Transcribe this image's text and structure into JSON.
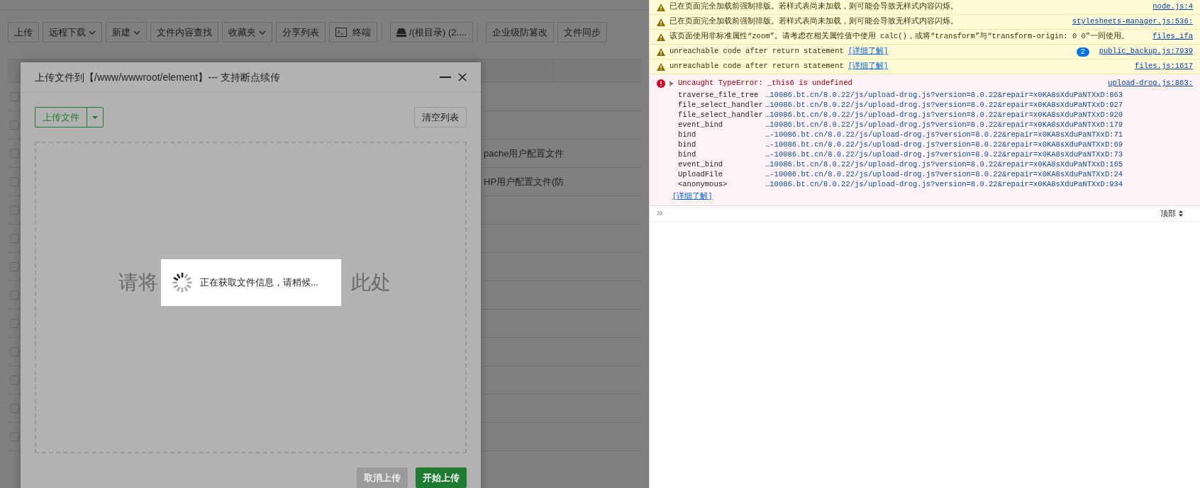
{
  "toolbar": [
    {
      "label": "上传",
      "kind": "plain"
    },
    {
      "label": "远程下载",
      "kind": "dropdown"
    },
    {
      "label": "新建",
      "kind": "dropdown"
    },
    {
      "label": "文件内容查找",
      "kind": "plain"
    },
    {
      "label": "收藏夹",
      "kind": "dropdown"
    },
    {
      "label": "分享列表",
      "kind": "plain"
    },
    {
      "label": "终端",
      "kind": "terminal"
    },
    {
      "label": "/(根目录) (2....",
      "kind": "disk"
    },
    {
      "label": "企业级防篡改",
      "kind": "plain"
    },
    {
      "label": "文件同步",
      "kind": "plain"
    }
  ],
  "table": {
    "rows": [
      {
        "checked": false
      },
      {
        "checked": false
      },
      {
        "checked": false,
        "cell": "pache用户配置文件"
      },
      {
        "checked": false,
        "cell": "HP用户配置文件(防"
      },
      {
        "checked": false
      },
      {
        "checked": false
      },
      {
        "checked": false
      },
      {
        "checked": false
      },
      {
        "checked": false
      },
      {
        "checked": false
      },
      {
        "checked": false
      },
      {
        "checked": false
      },
      {
        "checked": false
      }
    ]
  },
  "dialog": {
    "title": "上传文件到【/www/wwwroot/element】--- 支持断点续传",
    "upload_button": "上传文件",
    "clear_button": "清空列表",
    "drop_text_left": "请将",
    "drop_text_right": "此处",
    "loading": "正在获取文件信息，请稍候...",
    "cancel_button": {
      "label": "取消上传",
      "disabled": true
    },
    "start_button": {
      "label": "开始上传",
      "disabled": false
    }
  },
  "console": {
    "messages": [
      {
        "kind": "warning",
        "text": "已在页面完全加载前强制排版。若样式表尚未加载，则可能会导致无样式内容闪烁。",
        "source": "node.js:4"
      },
      {
        "kind": "warning",
        "text": "已在页面完全加载前强制排版。若样式表尚未加载，则可能会导致无样式内容闪烁。",
        "source": "stylesheets-manager.js:536:"
      },
      {
        "kind": "warning",
        "text": "该页面使用非标准属性“zoom”。请考虑在相关属性值中使用 calc()，或将“transform”与“transform-origin: 0 0”一同使用。",
        "source": "files_ifa"
      },
      {
        "kind": "warning",
        "text": "unreachable code after return statement",
        "link": "[详细了解]",
        "count": "2",
        "source": "public_backup.js:7939"
      },
      {
        "kind": "warning",
        "text": "unreachable code after return statement",
        "link": "[详细了解]",
        "source": "files.js:1617"
      },
      {
        "kind": "error",
        "text": "Uncaught TypeError: _this6 is undefined",
        "source": "upload-drog.js:863:",
        "expanded": false,
        "stack": [
          {
            "fn": "traverse_file_tree",
            "url": "…10086.bt.cn/8.0.22/js/upload-drog.js?version=8.0.22&repair=x0KA8sXduPaNTXxD:863"
          },
          {
            "fn": "file_select_handler",
            "url": "…10086.bt.cn/8.0.22/js/upload-drog.js?version=8.0.22&repair=x0KA8sXduPaNTXxD:927"
          },
          {
            "fn": "file_select_handler",
            "url": "…10086.bt.cn/8.0.22/js/upload-drog.js?version=8.0.22&repair=x0KA8sXduPaNTXxD:920"
          },
          {
            "fn": "event_bind",
            "url": "…10086.bt.cn/8.0.22/js/upload-drog.js?version=8.0.22&repair=x0KA8sXduPaNTXxD:179"
          },
          {
            "fn": "bind",
            "url": "…-10086.bt.cn/8.0.22/js/upload-drog.js?version=8.0.22&repair=x0KA8sXduPaNTXxD:71"
          },
          {
            "fn": "bind",
            "url": "…-10086.bt.cn/8.0.22/js/upload-drog.js?version=8.0.22&repair=x0KA8sXduPaNTXxD:69"
          },
          {
            "fn": "bind",
            "url": "…-10086.bt.cn/8.0.22/js/upload-drog.js?version=8.0.22&repair=x0KA8sXduPaNTXxD:73"
          },
          {
            "fn": "event_bind",
            "url": "…10086.bt.cn/8.0.22/js/upload-drog.js?version=8.0.22&repair=x0KA8sXduPaNTXxD:165"
          },
          {
            "fn": "UploadFile",
            "url": "…-10086.bt.cn/8.0.22/js/upload-drog.js?version=8.0.22&repair=x0KA8sXduPaNTXxD:24"
          },
          {
            "fn": "<anonymous>",
            "url": "…10086.bt.cn/8.0.22/js/upload-drog.js?version=8.0.22&repair=x0KA8sXduPaNTXxD:934"
          }
        ],
        "more_link": "[详细了解]"
      }
    ],
    "prompt": "»",
    "context": "顶部"
  }
}
